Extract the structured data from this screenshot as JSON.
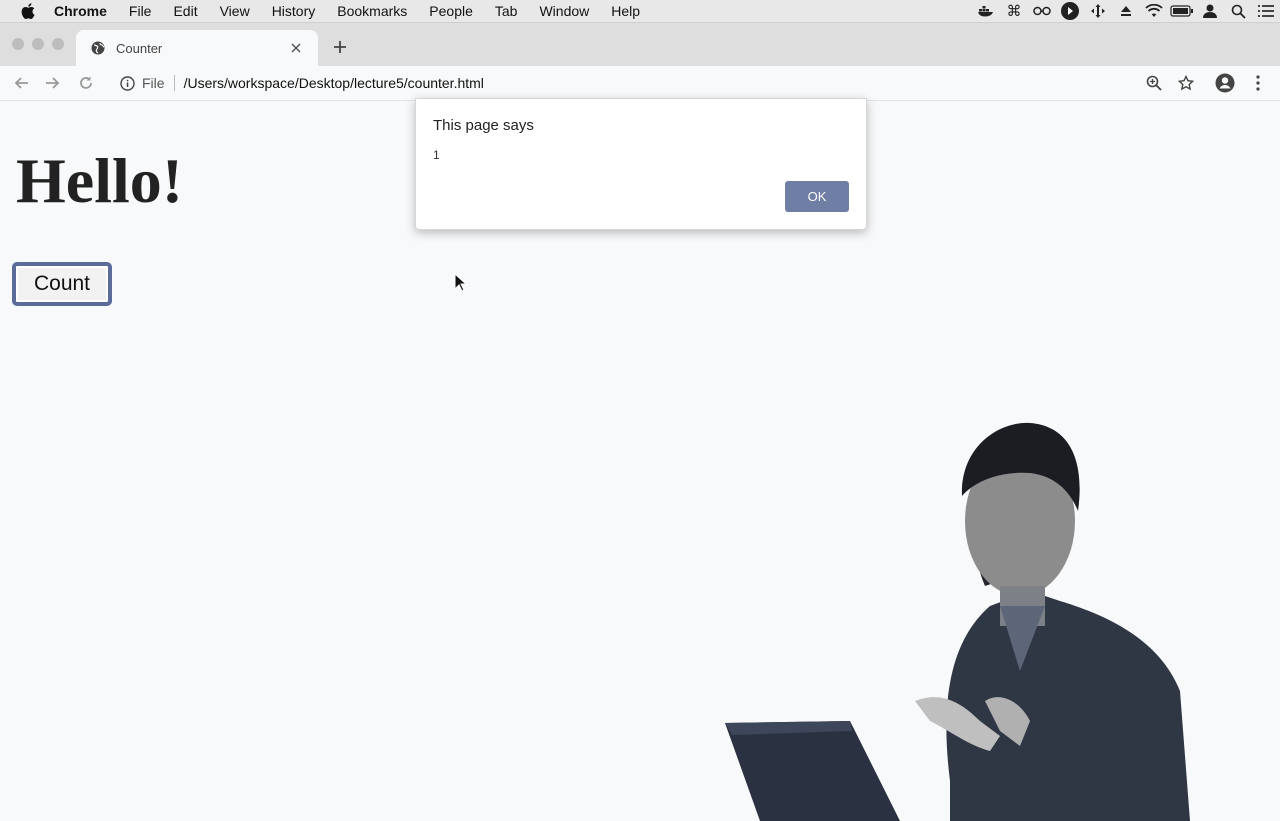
{
  "menubar": {
    "app": "Chrome",
    "items": [
      "File",
      "Edit",
      "View",
      "History",
      "Bookmarks",
      "People",
      "Tab",
      "Window",
      "Help"
    ]
  },
  "tab": {
    "title": "Counter"
  },
  "toolbar": {
    "scheme_label": "File",
    "url": "/Users/workspace/Desktop/lecture5/counter.html"
  },
  "page": {
    "heading": "Hello!",
    "count_button": "Count"
  },
  "dialog": {
    "title": "This page says",
    "message": "1",
    "ok_label": "OK"
  },
  "colors": {
    "accent_button": "#6e7ea4",
    "focus_ring": "#5b6c9a"
  }
}
